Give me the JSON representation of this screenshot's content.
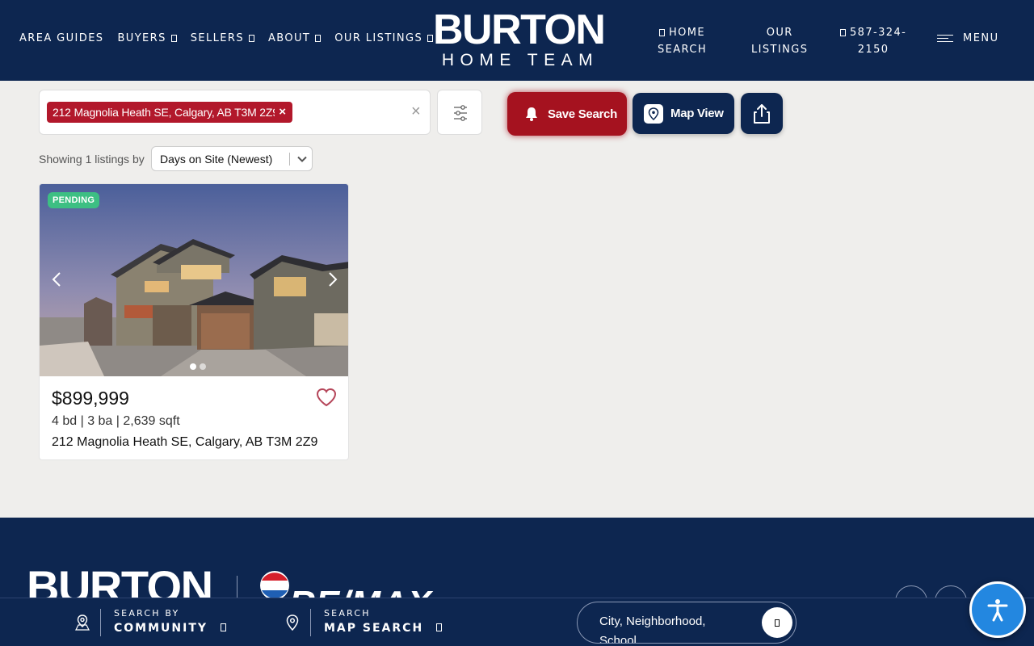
{
  "header": {
    "nav_left": [
      {
        "label": "AREA GUIDES",
        "caret": false
      },
      {
        "label": "BUYERS",
        "caret": true
      },
      {
        "label": "SELLERS",
        "caret": true
      },
      {
        "label": "ABOUT",
        "caret": true
      },
      {
        "label": "OUR LISTINGS",
        "caret": true
      }
    ],
    "logo_main": "BURTON",
    "logo_sub": "HOME TEAM",
    "home_search_l1": "HOME",
    "home_search_l2": "SEARCH",
    "our_listings_l1": "OUR",
    "our_listings_l2": "LISTINGS",
    "phone_l1": "587-324-",
    "phone_l2": "2150",
    "menu_label": "MENU"
  },
  "search": {
    "chip_label": "212 Magnolia Heath SE, Calgary, AB T3M 2Z9",
    "chip_remove": "×",
    "clear": "×"
  },
  "actions": {
    "save_search": "Save Search",
    "map_view": "Map View"
  },
  "results": {
    "showing_text": "Showing 1 listings by",
    "sort_value": "Days on Site (Newest)"
  },
  "listing": {
    "status": "PENDING",
    "price": "$899,999",
    "specs": "4 bd | 3 ba | 2,639 sqft",
    "address": "212 Magnolia Heath SE, Calgary, AB T3M 2Z9",
    "photo_count": 2,
    "active_photo": 1
  },
  "footer": {
    "logo_text": "BURTON",
    "brokerage_text": "RE/MAX"
  },
  "bottom_bar": {
    "community_l1": "SEARCH BY",
    "community_l2": "COMMUNITY",
    "map_l1": "SEARCH",
    "map_l2": "MAP SEARCH",
    "search_placeholder": "City, Neighborhood, School"
  },
  "colors": {
    "navy": "#0d2650",
    "red": "#a5121f",
    "pending_green": "#3dbf83",
    "accessibility_blue": "#2387e0"
  },
  "icons": {
    "save_search": "bell-icon",
    "map_view": "map-pin-icon",
    "share": "share-icon",
    "filter": "sliders-icon",
    "favorite": "heart-icon",
    "accessibility": "accessibility-icon"
  }
}
